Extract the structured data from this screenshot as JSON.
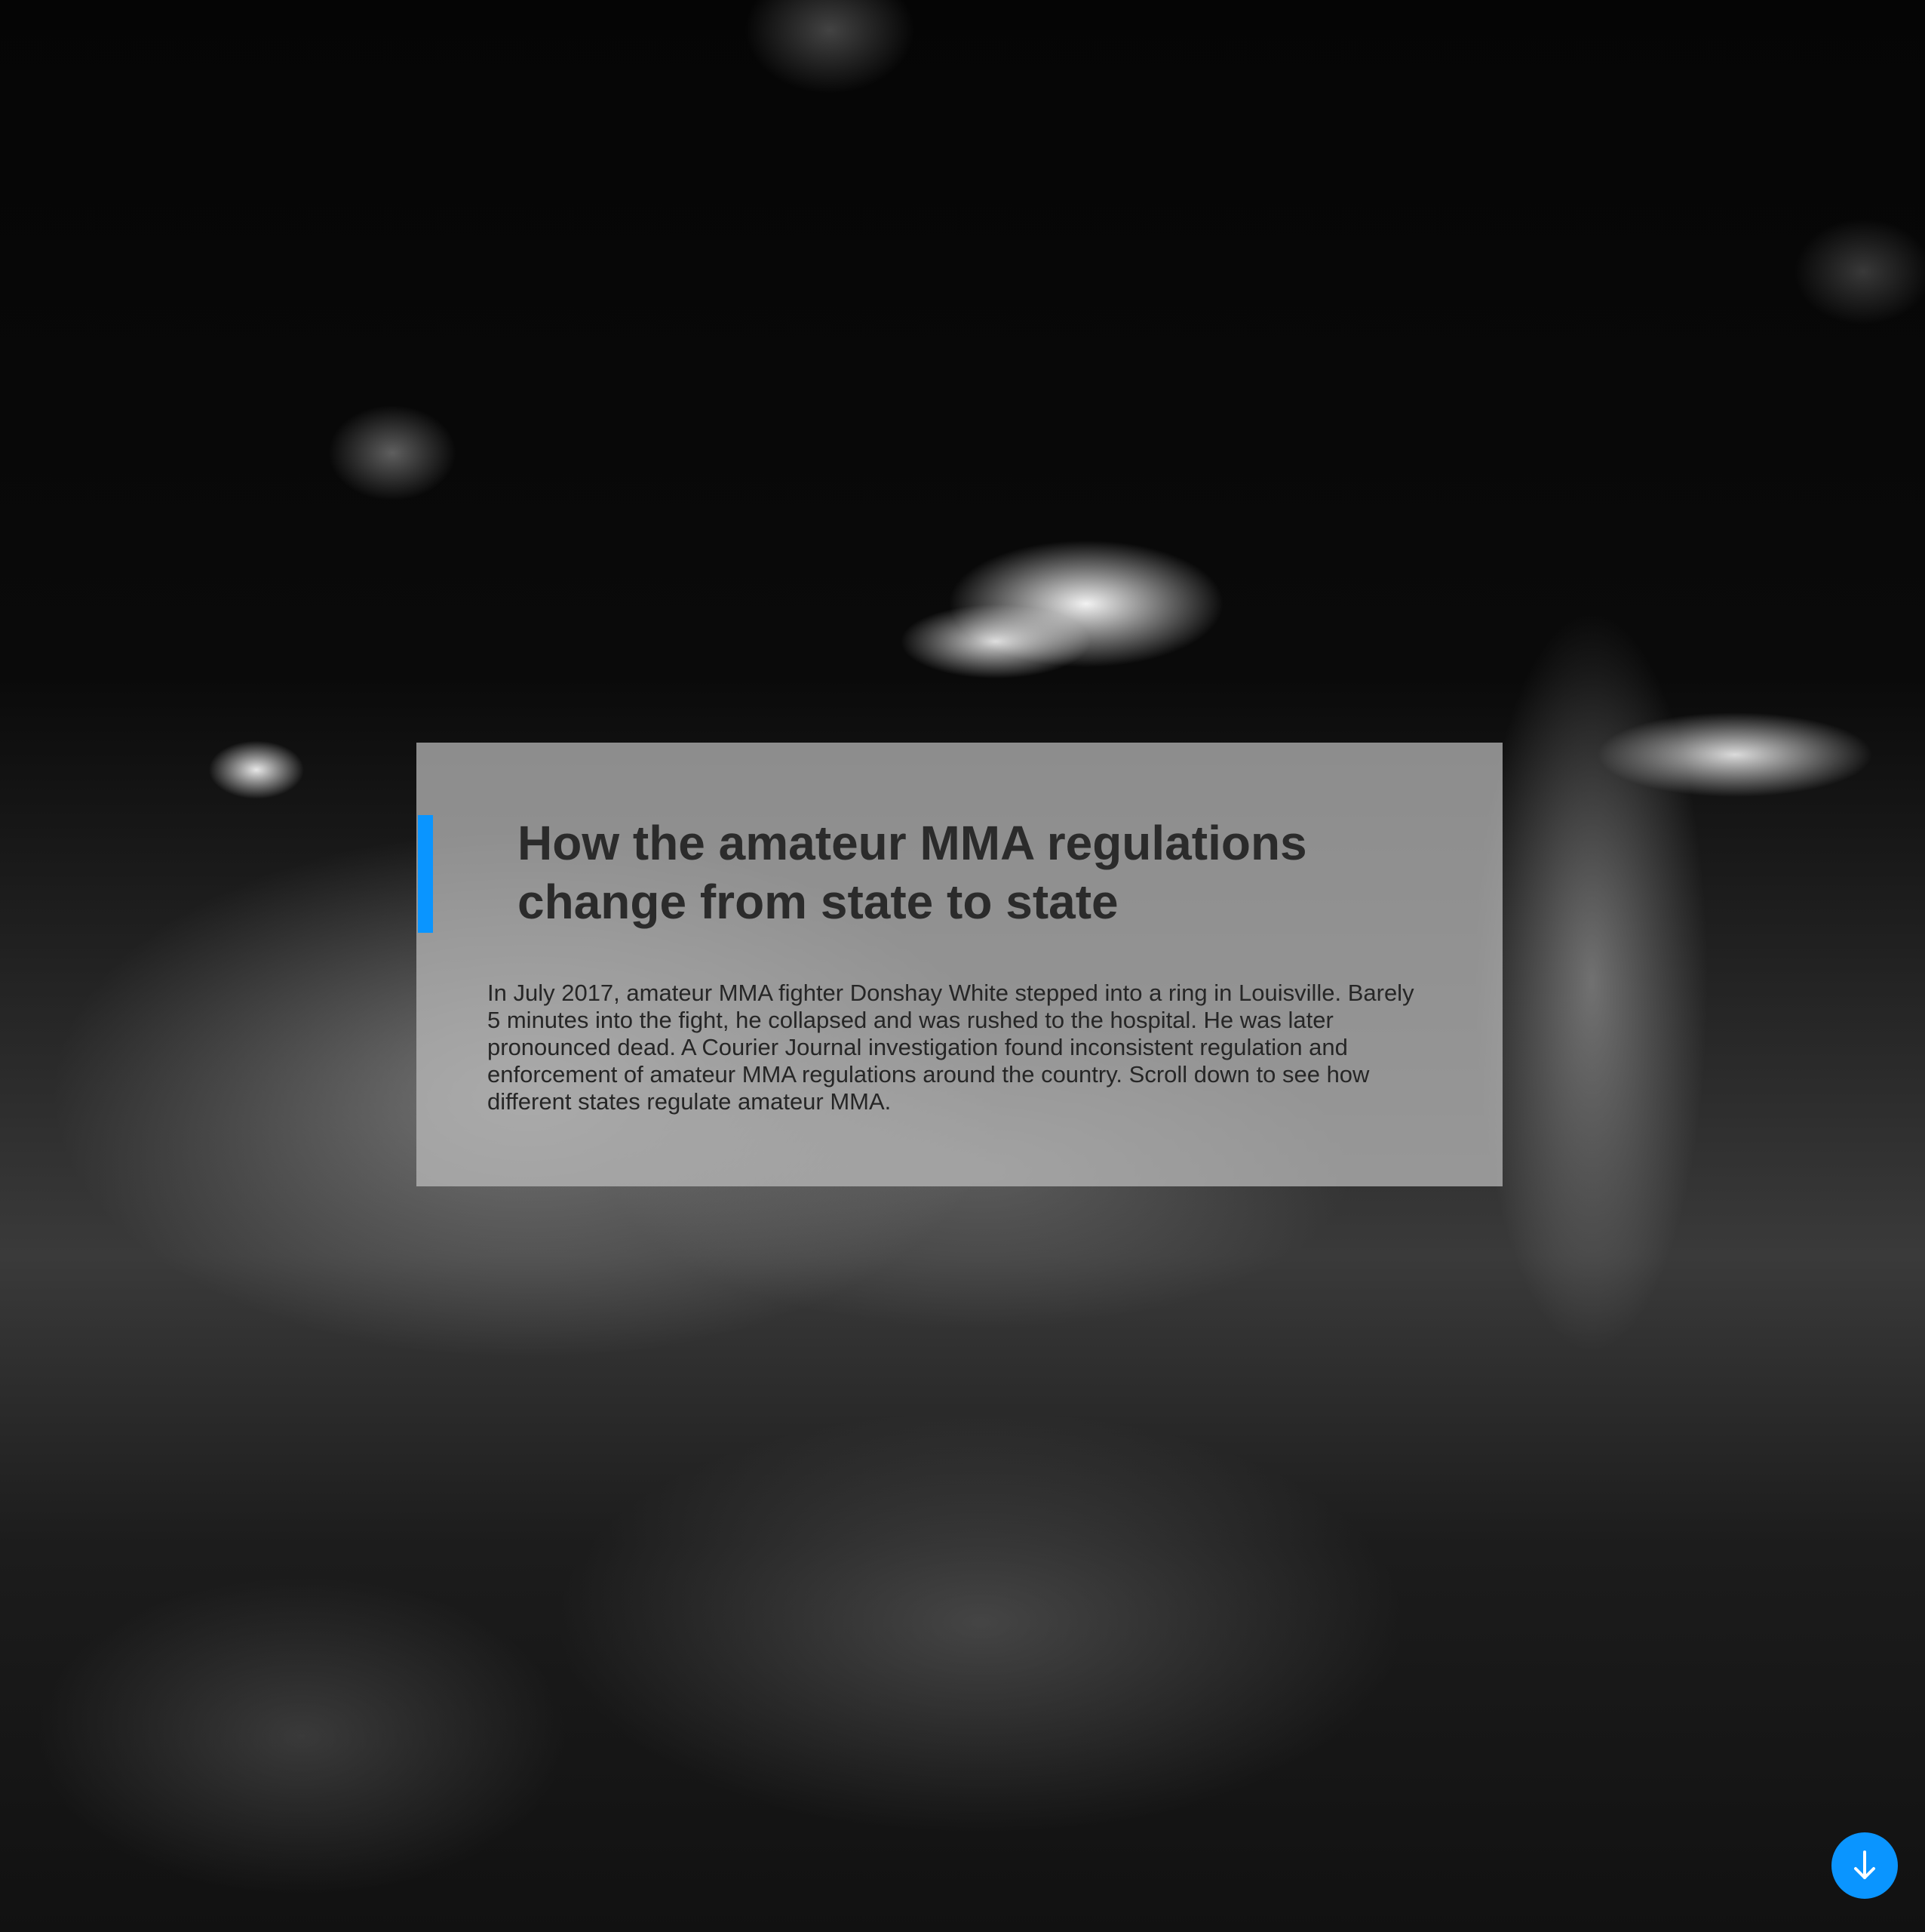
{
  "hero": {
    "headline": "How the amateur MMA regulations change from state to state",
    "intro": "In July 2017, amateur MMA fighter Donshay White stepped into a ring in Louisville. Barely 5 minutes into the fight, he collapsed and was rushed to the hospital. He was later pronounced dead. A Courier Journal investigation found inconsistent regulation and enforcement of amateur MMA regulations around the country. Scroll down to see how different states regulate amateur MMA."
  },
  "scroll_button": {
    "icon": "arrow-down-icon",
    "color": "#0a95ff"
  },
  "colors": {
    "accent": "#0a95ff",
    "card_background": "rgba(190,190,190,0.72)",
    "text": "#2b2b2b"
  }
}
